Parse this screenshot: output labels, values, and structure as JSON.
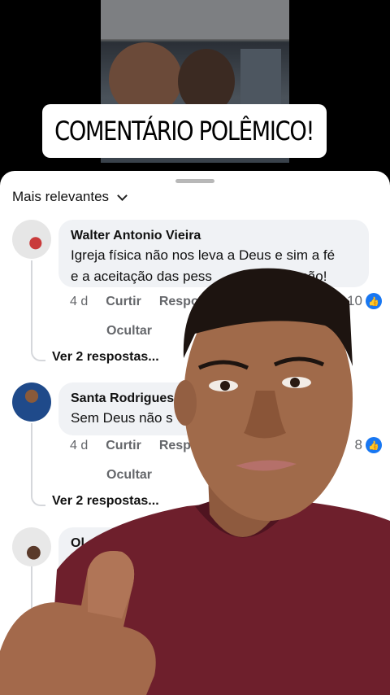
{
  "banner": {
    "text": "COMENTÁRIO POLÊMICO!"
  },
  "sheet": {
    "sort_label": "Mais relevantes"
  },
  "comments": [
    {
      "author": "Walter Antonio Vieira",
      "line1": "Igreja física não nos leva a Deus e sim a fé",
      "line2": "e a aceitação das pess",
      "line2_end": "elas são!",
      "time": "4 d",
      "like": "Curtir",
      "reply": "Respo",
      "hide": "Ocultar",
      "reactions": "10",
      "view_replies": "Ver 2 respostas..."
    },
    {
      "author": "Santa Rodrigues",
      "line1": "Sem Deus não s",
      "time": "4 d",
      "like": "Curtir",
      "reply": "Respo",
      "hide": "Ocultar",
      "reactions": "8",
      "view_replies": "Ver 2 respostas..."
    },
    {
      "author": "Ol"
    }
  ],
  "icons": {
    "like": "like-thumb-icon",
    "sort": "chevron-down-icon"
  },
  "colors": {
    "accent": "#1877f2",
    "bubble": "#f0f2f5",
    "shirt": "#6e1f2c"
  }
}
